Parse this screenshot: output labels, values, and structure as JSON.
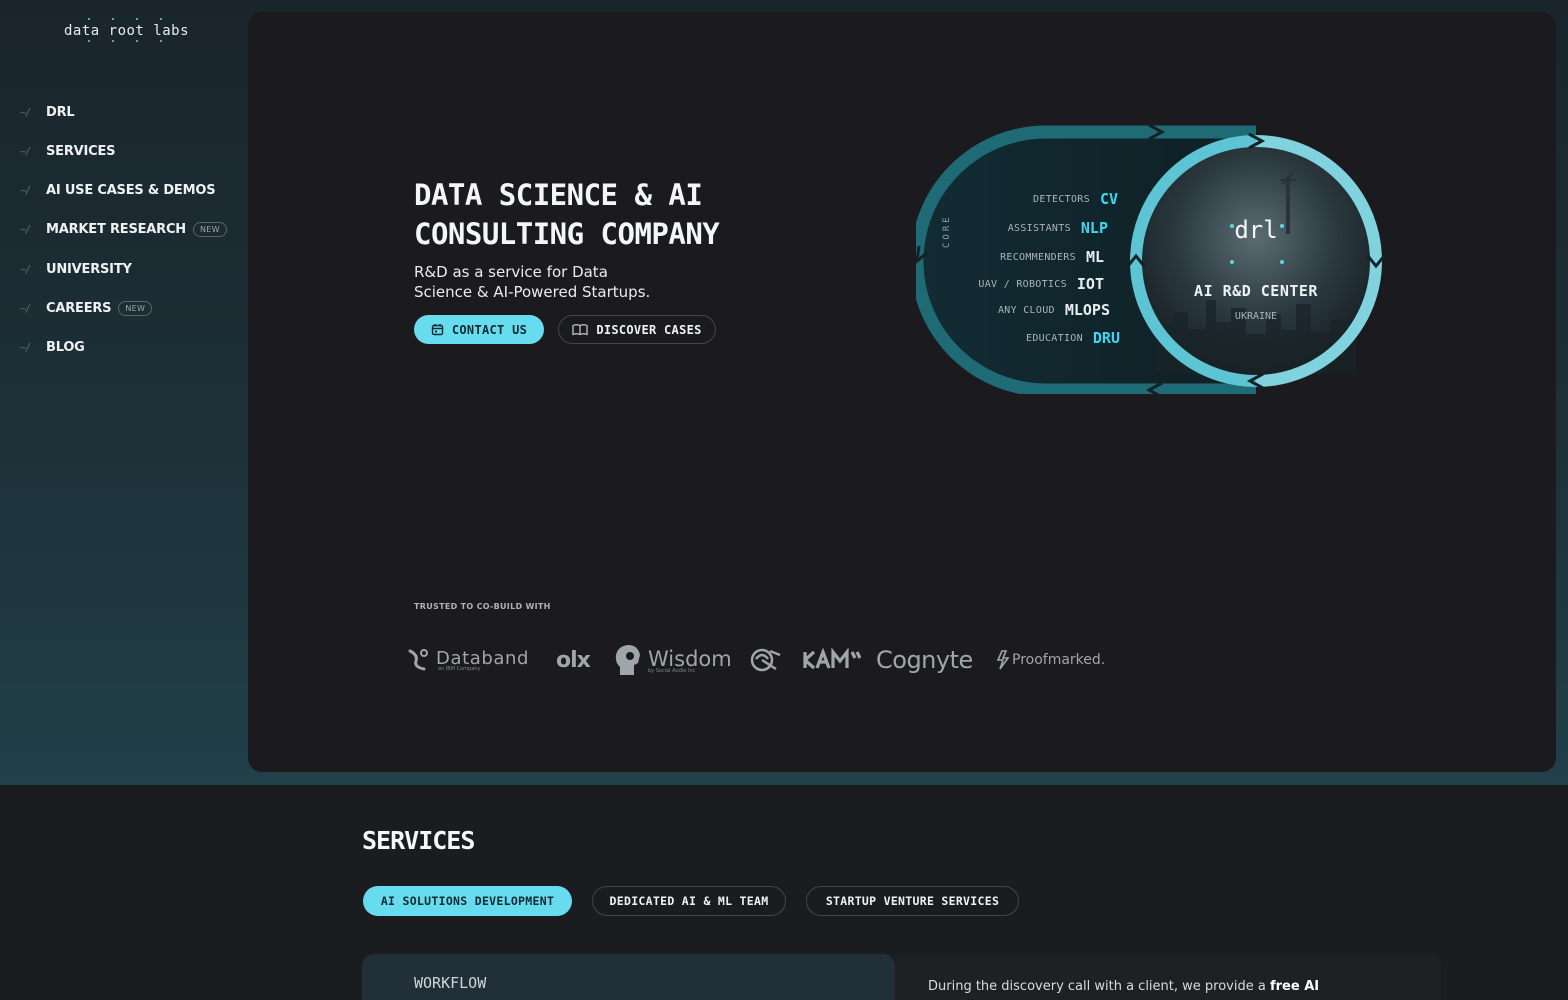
{
  "logo": {
    "text": "data root labs"
  },
  "nav": {
    "items": [
      {
        "label": "DRL",
        "badge": ""
      },
      {
        "label": "SERVICES",
        "badge": ""
      },
      {
        "label": "AI USE CASES & DEMOS",
        "badge": ""
      },
      {
        "label": "MARKET RESEARCH",
        "badge": "NEW"
      },
      {
        "label": "UNIVERSITY",
        "badge": ""
      },
      {
        "label": "CAREERS",
        "badge": "NEW"
      },
      {
        "label": "BLOG",
        "badge": ""
      }
    ],
    "tick_glyph": "~/"
  },
  "hero": {
    "title_line1": "DATA SCIENCE & AI",
    "title_line2": "CONSULTING COMPANY",
    "subtitle_line1": "R&D as a service for Data",
    "subtitle_line2": "Science & AI-Powered Startups.",
    "contact_label": "CONTACT US",
    "contact_icon": "calendar-icon",
    "cases_label": "DISCOVER CASES",
    "cases_icon": "book-icon",
    "trusted_label": "TRUSTED TO CO-BUILD WITH"
  },
  "partners": [
    {
      "name": "Databand",
      "sub": "an IBM Company"
    },
    {
      "name": "olx",
      "sub": ""
    },
    {
      "name": "Wisdom",
      "sub": "by Social Audio Inc"
    },
    {
      "name": "Cognyte",
      "sub": ""
    },
    {
      "name": "Proofmarked.",
      "sub": ""
    }
  ],
  "diagram": {
    "core_label": "CORE",
    "capabilities": [
      {
        "label": "DETECTORS",
        "code": "CV",
        "color": "#3fd6ef"
      },
      {
        "label": "ASSISTANTS",
        "code": "NLP",
        "color": "#3fd6ef"
      },
      {
        "label": "RECOMMENDERS",
        "code": "ML",
        "color": "#e8eef0"
      },
      {
        "label": "UAV / ROBOTICS",
        "code": "IOT",
        "color": "#e8eef0"
      },
      {
        "label": "ANY CLOUD",
        "code": "MLOPS",
        "color": "#e8eef0"
      },
      {
        "label": "EDUCATION",
        "code": "DRU",
        "color": "#3fd6ef"
      }
    ],
    "center_logo": "drl",
    "center_title": "AI R&D CENTER",
    "center_subtitle": "UKRAINE"
  },
  "services": {
    "title": "SERVICES",
    "tabs": [
      {
        "label": "AI SOLUTIONS DEVELOPMENT",
        "active": true
      },
      {
        "label": "DEDICATED AI & ML TEAM",
        "active": false
      },
      {
        "label": "STARTUP VENTURE SERVICES",
        "active": false
      }
    ],
    "workflow_label": "WORKFLOW",
    "description_prefix": "During the discovery call with a client, we provide a ",
    "description_bold": "free AI"
  },
  "colors": {
    "accent": "#66dcee",
    "sidebar_bg": "#1d3038",
    "card_bg": "#1b1b1f"
  }
}
